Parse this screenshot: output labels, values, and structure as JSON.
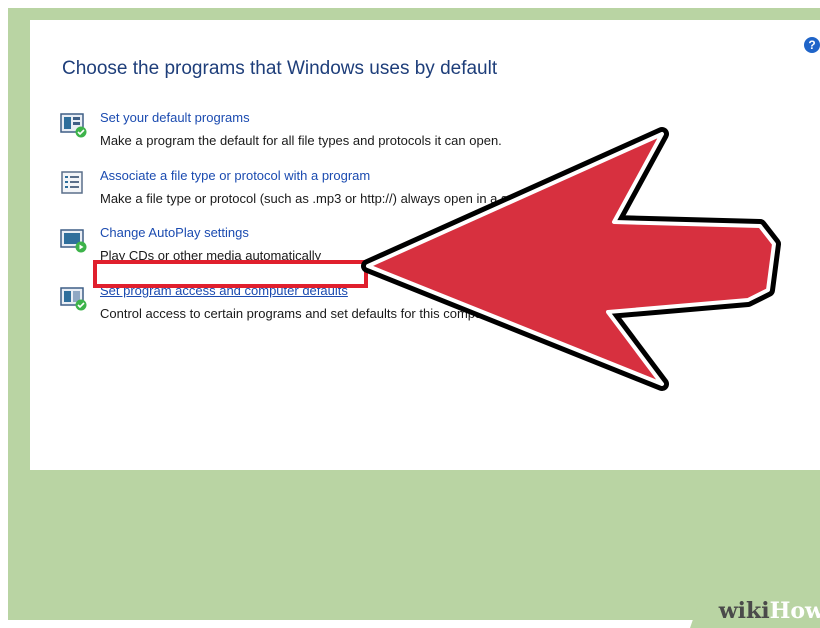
{
  "page": {
    "title": "Choose the programs that Windows uses by default",
    "help_icon": "question-circle-icon"
  },
  "options": [
    {
      "link": "Set your default programs",
      "description": "Make a program the default for all file types and protocols it can open.",
      "icon": "default-programs-icon"
    },
    {
      "link": "Associate a file type or protocol with a program",
      "description": "Make a file type or protocol (such as .mp3 or http://) always open in a specific program",
      "icon": "file-association-icon"
    },
    {
      "link": "Change AutoPlay settings",
      "description": "Play CDs or other media automatically",
      "icon": "autoplay-icon"
    },
    {
      "link": "Set program access and computer defaults",
      "description": "Control access to certain programs and set defaults for this computer",
      "icon": "program-access-icon",
      "highlighted": true
    }
  ],
  "annotation": {
    "arrow_color": "#d7303f",
    "box_color": "#e01f2d"
  },
  "watermark": {
    "part1": "wiki",
    "part2": "How"
  },
  "colors": {
    "background": "#b9d4a3",
    "link": "#1b4bb0",
    "title": "#1e3e7a"
  }
}
